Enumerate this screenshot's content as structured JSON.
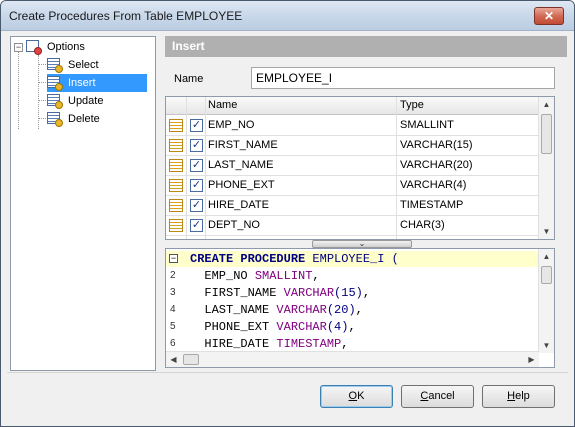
{
  "window": {
    "title": "Create Procedures From Table EMPLOYEE",
    "close_label": "✕"
  },
  "tree": {
    "root": {
      "label": "Options"
    },
    "items": [
      {
        "label": "Select"
      },
      {
        "label": "Insert"
      },
      {
        "label": "Update"
      },
      {
        "label": "Delete"
      }
    ],
    "selected": "Insert"
  },
  "panel": {
    "header": "Insert",
    "name_label": "Name",
    "name_value": "EMPLOYEE_I"
  },
  "grid": {
    "columns": [
      "Name",
      "Type"
    ],
    "rows": [
      {
        "name": "EMP_NO",
        "type": "SMALLINT",
        "checked": true
      },
      {
        "name": "FIRST_NAME",
        "type": "VARCHAR(15)",
        "checked": true
      },
      {
        "name": "LAST_NAME",
        "type": "VARCHAR(20)",
        "checked": true
      },
      {
        "name": "PHONE_EXT",
        "type": "VARCHAR(4)",
        "checked": true
      },
      {
        "name": "HIRE_DATE",
        "type": "TIMESTAMP",
        "checked": true
      },
      {
        "name": "DEPT_NO",
        "type": "CHAR(3)",
        "checked": true
      }
    ]
  },
  "code": {
    "lines": [
      {
        "no": "",
        "kw1": "CREATE PROCEDURE",
        "id": " EMPLOYEE_I (",
        "ty": ""
      },
      {
        "no": "2",
        "kw1": "",
        "id": "  EMP_NO ",
        "ty": "SMALLINT",
        "tail": ","
      },
      {
        "no": "3",
        "kw1": "",
        "id": "  FIRST_NAME ",
        "ty": "VARCHAR",
        "num": "(15)",
        "tail": ","
      },
      {
        "no": "4",
        "kw1": "",
        "id": "  LAST_NAME ",
        "ty": "VARCHAR",
        "num": "(20)",
        "tail": ","
      },
      {
        "no": "5",
        "kw1": "",
        "id": "  PHONE_EXT ",
        "ty": "VARCHAR",
        "num": "(4)",
        "tail": ","
      },
      {
        "no": "6",
        "kw1": "",
        "id": "  HIRE_DATE ",
        "ty": "TIMESTAMP",
        "tail": ","
      }
    ]
  },
  "buttons": {
    "ok": {
      "mnemonic": "O",
      "rest": "K"
    },
    "cancel": {
      "mnemonic": "C",
      "rest": "ancel"
    },
    "help": {
      "mnemonic": "H",
      "rest": "elp"
    }
  }
}
